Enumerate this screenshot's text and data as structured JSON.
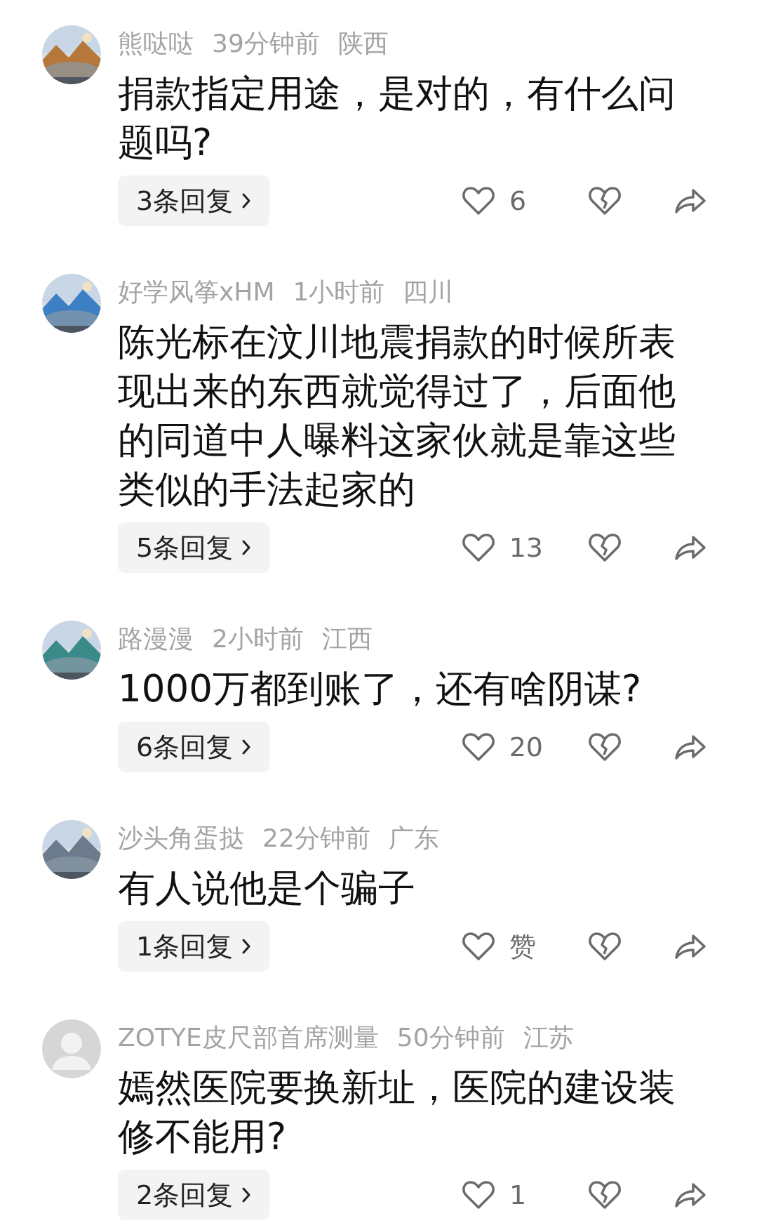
{
  "comments": [
    {
      "name": "熊哒哒",
      "time": "39分钟前",
      "location": "陕西",
      "text": "捐款指定用途，是对的，有什么问题吗?",
      "replies": "3条回复",
      "likes": "6"
    },
    {
      "name": "好学风筝xHM",
      "time": "1小时前",
      "location": "四川",
      "text": "陈光标在汶川地震捐款的时候所表现出来的东西就觉得过了，后面他的同道中人曝料这家伙就是靠这些类似的手法起家的",
      "replies": "5条回复",
      "likes": "13"
    },
    {
      "name": "路漫漫",
      "time": "2小时前",
      "location": "江西",
      "text": "1000万都到账了，还有啥阴谋?",
      "replies": "6条回复",
      "likes": "20"
    },
    {
      "name": "沙头角蛋挞",
      "time": "22分钟前",
      "location": "广东",
      "text": "有人说他是个骗子",
      "replies": "1条回复",
      "likes": "赞"
    },
    {
      "avatar": {
        "kind": "default"
      },
      "name": "ZOTYE皮尺部首席测量",
      "time": "50分钟前",
      "location": "江苏",
      "text": "嫣然医院要换新址，医院的建设装修不能用?",
      "replies": "2条回复",
      "likes": "1"
    }
  ]
}
